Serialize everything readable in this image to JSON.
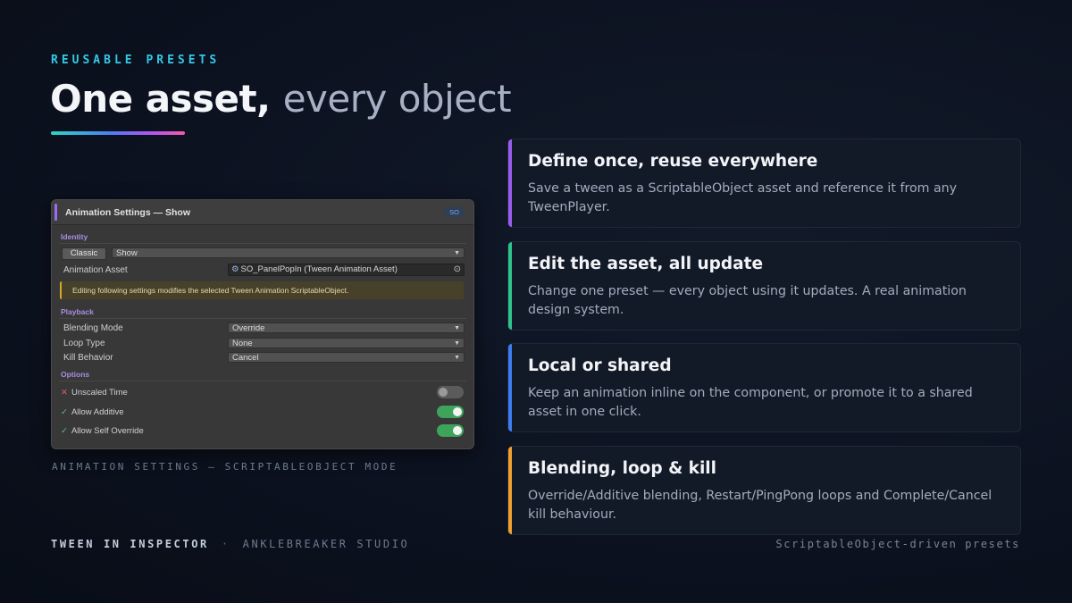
{
  "eyebrow": "REUSABLE PRESETS",
  "title": {
    "strong": "One asset,",
    "light": "every object"
  },
  "colors": {
    "background": "#0c1220",
    "eyebrow": "#35c9e6",
    "card_accents": [
      "#9b5cf0",
      "#2ec48d",
      "#3d7df2",
      "#f0a02c"
    ]
  },
  "inspector": {
    "header_title": "Animation Settings — Show",
    "badge": "SO",
    "sections": {
      "identity": "Identity",
      "playback": "Playback",
      "options": "Options"
    },
    "classic_button": "Classic",
    "show_dropdown": "Show",
    "animation_asset_label": "Animation Asset",
    "animation_asset_value": "SO_PanelPopIn (Tween Animation Asset)",
    "warning": "Editing following settings modifies the selected Tween Animation ScriptableObject.",
    "fields": [
      {
        "label": "Blending Mode",
        "value": "Override"
      },
      {
        "label": "Loop Type",
        "value": "None"
      },
      {
        "label": "Kill Behavior",
        "value": "Cancel"
      }
    ],
    "options": [
      {
        "label": "Unscaled Time",
        "enabled": false
      },
      {
        "label": "Allow Additive",
        "enabled": true
      },
      {
        "label": "Allow Self Override",
        "enabled": true
      }
    ]
  },
  "caption": "ANIMATION SETTINGS — SCRIPTABLEOBJECT MODE",
  "cards": [
    {
      "title": "Define once, reuse everywhere",
      "body": "Save a tween as a ScriptableObject asset and reference it from any TweenPlayer."
    },
    {
      "title": "Edit the asset, all update",
      "body": "Change one preset — every object using it updates. A real animation design system."
    },
    {
      "title": "Local or shared",
      "body": "Keep an animation inline on the component, or promote it to a shared asset in one click."
    },
    {
      "title": "Blending, loop & kill",
      "body": "Override/Additive blending, Restart/PingPong loops and Complete/Cancel kill behaviour."
    }
  ],
  "footer": {
    "product": "TWEEN IN INSPECTOR",
    "separator": "·",
    "studio": "ANKLEBREAKER STUDIO",
    "tagline": "ScriptableObject-driven presets"
  }
}
